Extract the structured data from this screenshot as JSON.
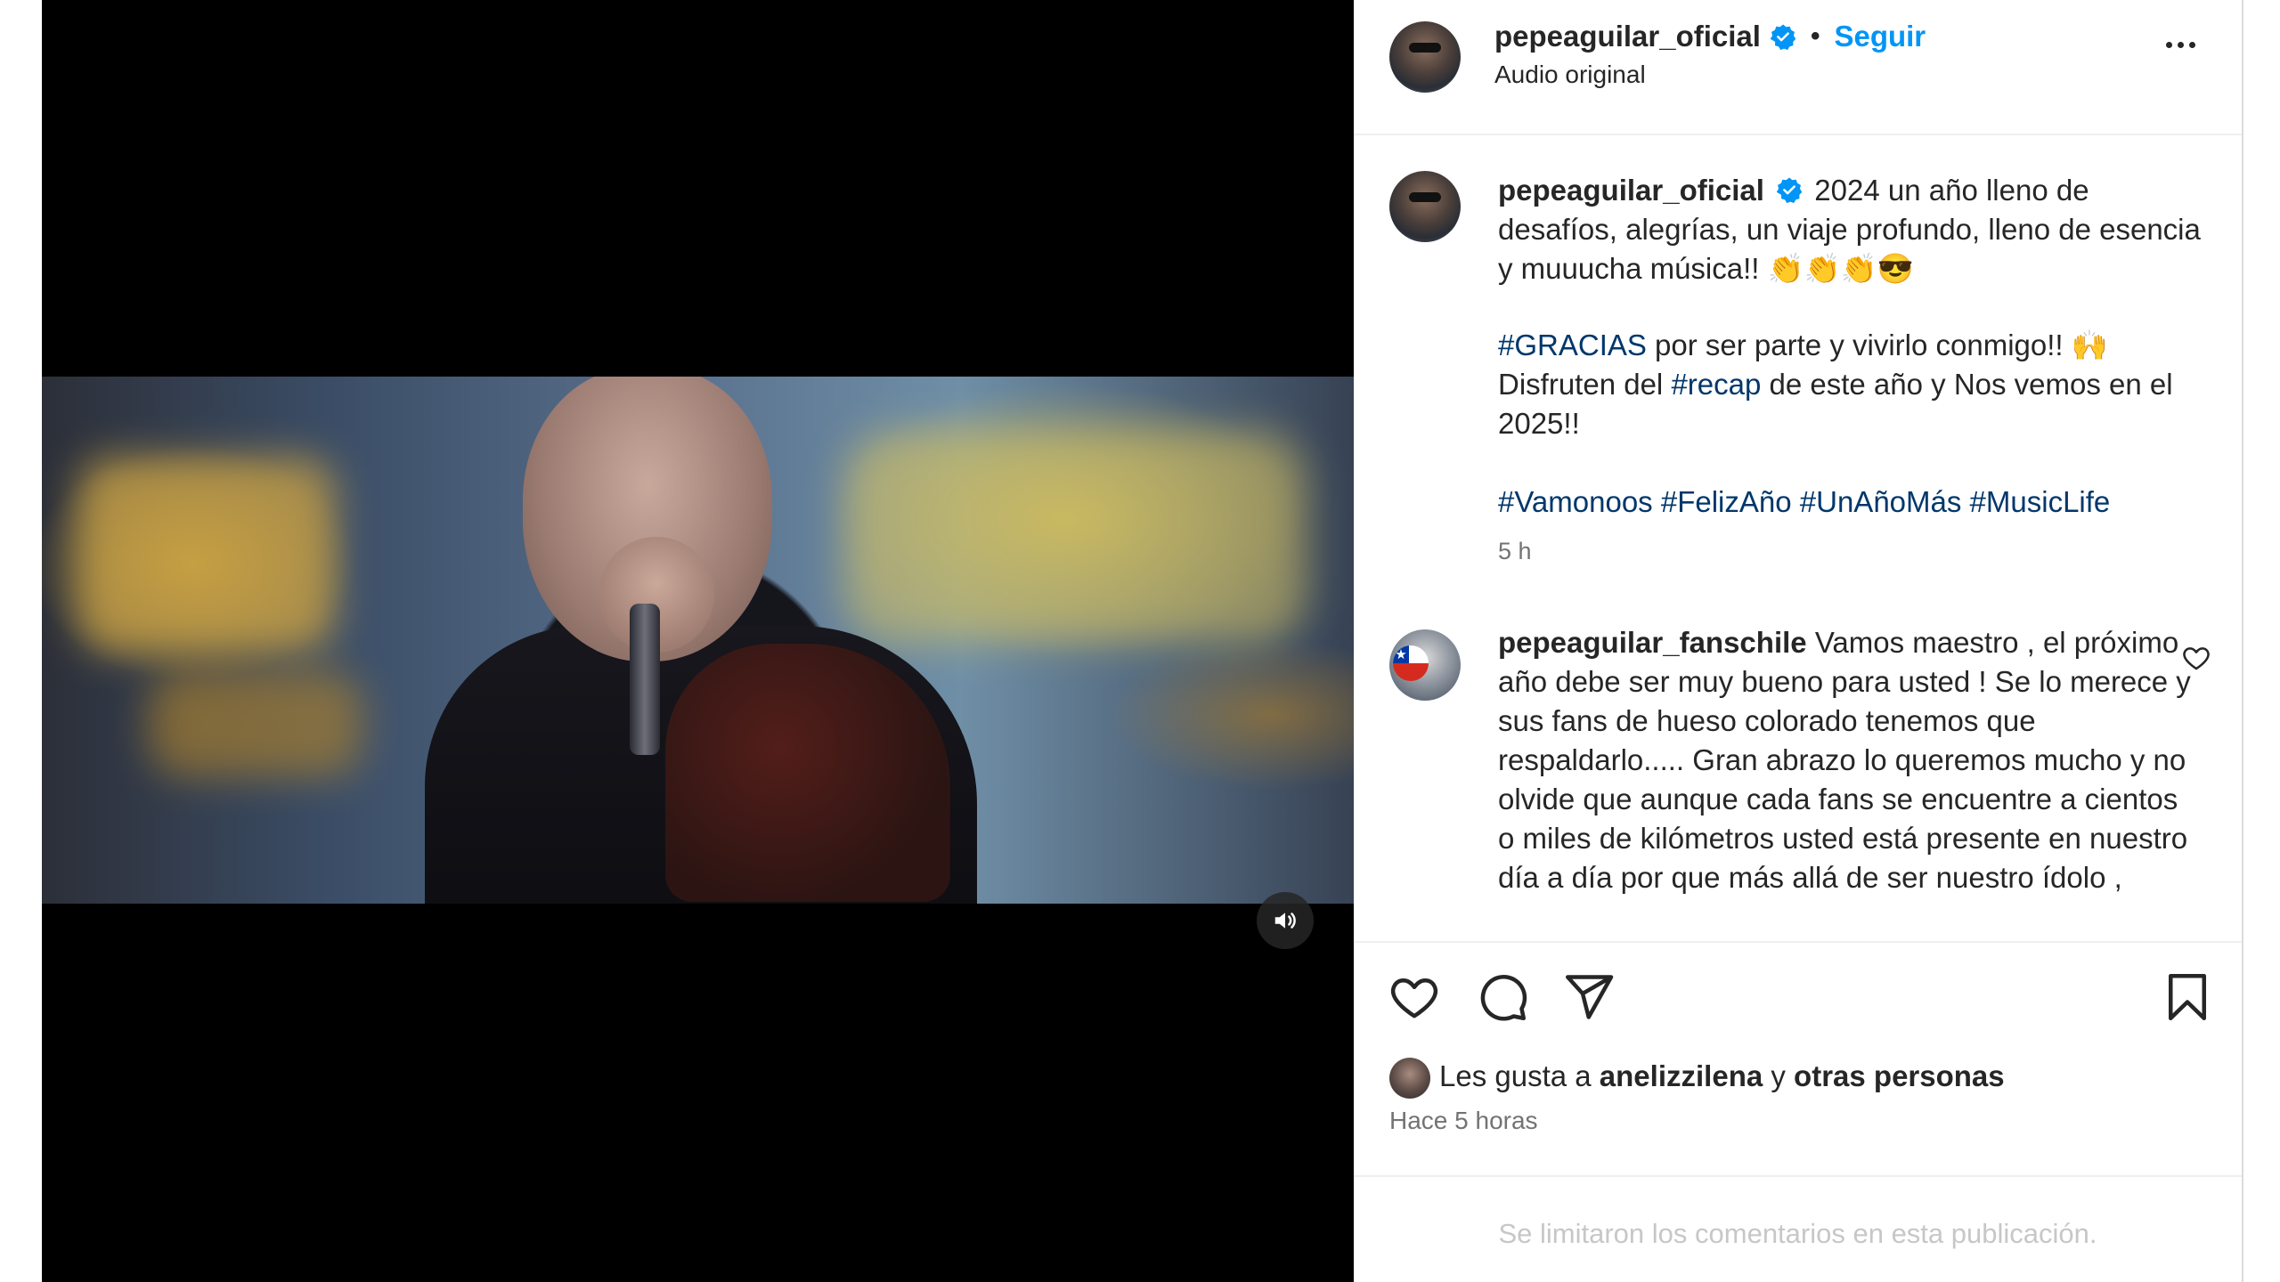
{
  "post": {
    "username": "pepeaguilar_oficial",
    "follow_label": "Seguir",
    "audio_label": "Audio original",
    "separator": "•"
  },
  "caption": {
    "text": "2024 un año lleno de desafíos, alegrías, un viaje profundo, lleno de esencia y muuucha música!! 👏👏👏😎",
    "hashtag_gracias": "#GRACIAS",
    "after_gracias": " por ser parte y vivirlo conmigo!! 🙌",
    "line_disfruten": "Disfruten del ",
    "hashtag_recap": "#recap",
    "after_recap": " de este año y Nos vemos en el 2025!!",
    "hashtags": [
      "#Vamonoos",
      "#FelizAño",
      "#UnAñoMás",
      "#MusicLife"
    ],
    "time": "5 h"
  },
  "comment": {
    "username": "pepeaguilar_fanschile",
    "text": "Vamos maestro , el próximo año debe ser muy bueno para usted ! Se lo merece y sus fans de hueso colorado tenemos que respaldarlo..... Gran abrazo lo queremos mucho y no olvide que aunque cada fans se encuentre a cientos o miles de kilómetros usted está presente en nuestro día a día por que más allá de ser nuestro ídolo ,"
  },
  "likes": {
    "prefix": "Les gusta a ",
    "user": "anelizzilena",
    "middle": " y ",
    "others": "otras personas"
  },
  "post_time": "Hace 5 horas",
  "footer": {
    "comments_limited": "Se limitaron los comentarios en esta publicación."
  },
  "icons": {
    "verified": "verified-badge-icon",
    "more": "more-options-icon",
    "sound": "speaker-icon",
    "like": "heart-icon",
    "comment": "comment-bubble-icon",
    "share": "paper-plane-icon",
    "save": "bookmark-icon"
  },
  "colors": {
    "link_blue": "#0095f6",
    "hashtag_blue": "#00376b",
    "verified_blue": "#0095f6",
    "text": "#262626",
    "muted": "#737373"
  }
}
